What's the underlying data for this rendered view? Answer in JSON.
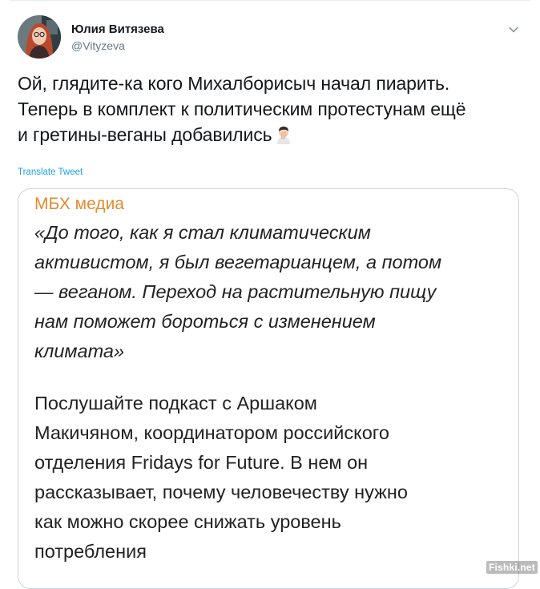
{
  "user": {
    "display_name": "Юлия Витязева",
    "handle": "@Vityzeva",
    "avatar_icon": "avatar-photo"
  },
  "tweet": {
    "text": "Ой, глядите-ка кого Михалборисыч начал пиарить.\nТеперь в комплект к политическим протестунам ещё\nи гретины-веганы добавились",
    "emoji_icon": "facepalm-emoji",
    "translate_label": "Translate Tweet"
  },
  "card": {
    "source": "МБХ медиа",
    "quote": "«До того, как я стал климатическим\nактивистом, я был вегетарианцем, а потом\n— веганом. Переход на растительную пищу\nнам поможет бороться с изменением\nклимата»",
    "body": "Послушайте подкаст с Аршаком\nМакичяном, координатором российского\nотделения Fridays for Future. В нем он\nрассказывает, почему человечеству нужно\nкак можно скорее снижать уровень\nпотребления"
  },
  "watermark": "Fishki.net",
  "colors": {
    "link_blue": "#1da1f2",
    "source_orange": "#e08b2f",
    "secondary_text": "#657786",
    "border": "#ccd6dd"
  }
}
